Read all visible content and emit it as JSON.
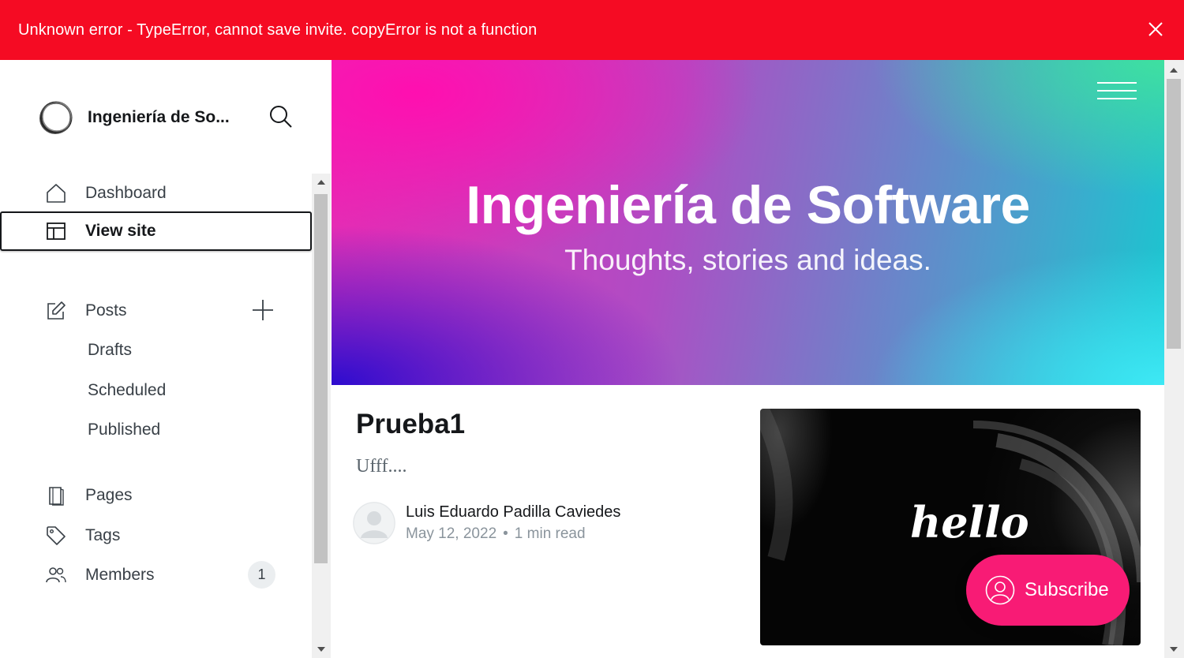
{
  "alert": {
    "message": "Unknown error - TypeError, cannot save invite. copyError is not a function",
    "background": "#f50b23"
  },
  "sidebar": {
    "site_title": "Ingeniería de So...",
    "items": [
      {
        "label": "Dashboard",
        "icon": "home-icon"
      },
      {
        "label": "View site",
        "icon": "view-site-icon",
        "active": true
      },
      {
        "label": "Posts",
        "icon": "posts-icon"
      },
      {
        "label": "Drafts"
      },
      {
        "label": "Scheduled"
      },
      {
        "label": "Published"
      },
      {
        "label": "Pages",
        "icon": "pages-icon"
      },
      {
        "label": "Tags",
        "icon": "tag-icon"
      },
      {
        "label": "Members",
        "icon": "members-icon",
        "badge": "1"
      }
    ]
  },
  "site": {
    "title": "Ingeniería de Software",
    "description": "Thoughts, stories and ideas.",
    "post": {
      "title": "Prueba1",
      "excerpt": "Ufff....",
      "author": "Luis Eduardo Padilla Caviedes",
      "date": "May 12, 2022",
      "read_time": "1 min read",
      "image_text": "hello"
    },
    "subscribe_label": "Subscribe",
    "accent": "#f81b75"
  }
}
